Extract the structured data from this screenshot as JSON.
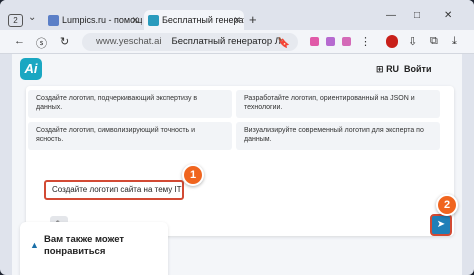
{
  "browser": {
    "tab_count": "2",
    "tabs": [
      {
        "label": "Lumpics.ru - помощь с ко"
      },
      {
        "label": "Бесплатный генерато"
      }
    ],
    "new_tab": "+",
    "window": {
      "minimize": "—",
      "maximize": "□",
      "close": "✕"
    },
    "address": {
      "domain": "www.yeschat.ai",
      "title": "Бесплатный генератор Л"
    }
  },
  "site": {
    "logo": "Ai",
    "language": "RU",
    "login": "Войти"
  },
  "suggestions": [
    "Создайте логотип, подчеркивающий экспертизу в данных.",
    "Разработайте логотип, ориентированный на JSON и технологии.",
    "Создайте логотип, символизирующий точность и ясность.",
    "Визуализируйте современный логотип для эксперта по данным."
  ],
  "input": {
    "value": "Создайте логотип сайта на тему IT"
  },
  "badges": {
    "first": "1",
    "second": "2"
  },
  "related": {
    "title": "Вам также может понравиться"
  },
  "colors": {
    "accent": "#1aa7c2",
    "highlight": "#d24a34",
    "badge": "#f0651f",
    "send": "#1f7fb8"
  }
}
